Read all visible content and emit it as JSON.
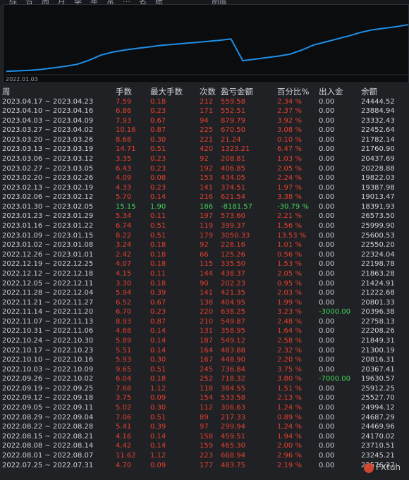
{
  "tabs": [
    "综",
    "合",
    "周",
    "月",
    "季",
    "年",
    "常",
    "…",
    "名",
    "账",
    "制度"
  ],
  "chart": {
    "start_label": "2022.01.03",
    "line_color": "#1e8fe8",
    "equity_series": [
      0.08,
      0.09,
      0.1,
      0.12,
      0.15,
      0.18,
      0.22,
      0.3,
      0.4,
      0.46,
      0.5,
      0.53,
      0.56,
      0.59,
      0.61,
      0.63,
      0.65,
      0.67,
      0.69,
      0.72,
      0.29,
      0.32,
      0.35,
      0.38,
      0.42,
      0.5,
      0.6,
      0.66,
      0.72,
      0.78,
      0.85,
      0.9,
      0.93,
      0.96,
      1.0
    ]
  },
  "table": {
    "headers": [
      "周",
      "手数",
      "最大手数",
      "次数",
      "盈亏金额",
      "百分比%",
      "出入金",
      "余额"
    ],
    "rows": [
      {
        "week": "2023.04.17 ~ 2023.04.23",
        "lots": "7.59",
        "max_lots": "0.18",
        "count": "212",
        "pnl": "559.58",
        "pct": "2.34 %",
        "flow": "0.00",
        "balance": "24444.52",
        "sign": "pos"
      },
      {
        "week": "2023.04.10 ~ 2023.04.16",
        "lots": "6.86",
        "max_lots": "0.23",
        "count": "171",
        "pnl": "552.51",
        "pct": "2.37 %",
        "flow": "0.00",
        "balance": "23884.94",
        "sign": "pos"
      },
      {
        "week": "2023.04.03 ~ 2023.04.09",
        "lots": "7.93",
        "max_lots": "0.67",
        "count": "94",
        "pnl": "879.79",
        "pct": "3.92 %",
        "flow": "0.00",
        "balance": "23332.43",
        "sign": "pos"
      },
      {
        "week": "2023.03.27 ~ 2023.04.02",
        "lots": "10.16",
        "max_lots": "0.87",
        "count": "225",
        "pnl": "670.50",
        "pct": "3.08 %",
        "flow": "0.00",
        "balance": "22452.64",
        "sign": "pos"
      },
      {
        "week": "2023.03.20 ~ 2023.03.26",
        "lots": "8.68",
        "max_lots": "0.30",
        "count": "221",
        "pnl": "21.24",
        "pct": "0.10 %",
        "flow": "0.00",
        "balance": "21782.14",
        "sign": "pos"
      },
      {
        "week": "2023.03.13 ~ 2023.03.19",
        "lots": "14.71",
        "max_lots": "0.51",
        "count": "420",
        "pnl": "1323.21",
        "pct": "6.47 %",
        "flow": "0.00",
        "balance": "21760.90",
        "sign": "pos"
      },
      {
        "week": "2023.03.06 ~ 2023.03.12",
        "lots": "3.35",
        "max_lots": "0.23",
        "count": "92",
        "pnl": "208.81",
        "pct": "1.03 %",
        "flow": "0.00",
        "balance": "20437.69",
        "sign": "pos"
      },
      {
        "week": "2023.02.27 ~ 2023.03.05",
        "lots": "6.43",
        "max_lots": "0.23",
        "count": "192",
        "pnl": "406.85",
        "pct": "2.05 %",
        "flow": "0.00",
        "balance": "20228.88",
        "sign": "pos"
      },
      {
        "week": "2023.02.20 ~ 2023.02.26",
        "lots": "4.09",
        "max_lots": "0.08",
        "count": "153",
        "pnl": "434.05",
        "pct": "2.24 %",
        "flow": "0.00",
        "balance": "19822.03",
        "sign": "pos"
      },
      {
        "week": "2023.02.13 ~ 2023.02.19",
        "lots": "4.33",
        "max_lots": "0.23",
        "count": "141",
        "pnl": "374.51",
        "pct": "1.97 %",
        "flow": "0.00",
        "balance": "19387.98",
        "sign": "pos"
      },
      {
        "week": "2023.02.06 ~ 2023.02.12",
        "lots": "5.70",
        "max_lots": "0.14",
        "count": "216",
        "pnl": "621.54",
        "pct": "3.38 %",
        "flow": "0.00",
        "balance": "19013.47",
        "sign": "pos"
      },
      {
        "week": "2023.01.30 ~ 2023.02.05",
        "lots": "15.15",
        "max_lots": "1.90",
        "count": "186",
        "pnl": "-8181.57",
        "pct": "-30.79 %",
        "flow": "0.00",
        "balance": "18391.93",
        "sign": "neg"
      },
      {
        "week": "2023.01.23 ~ 2023.01.29",
        "lots": "5.34",
        "max_lots": "0.11",
        "count": "197",
        "pnl": "573.60",
        "pct": "2.21 %",
        "flow": "0.00",
        "balance": "26573.50",
        "sign": "pos"
      },
      {
        "week": "2023.01.16 ~ 2023.01.22",
        "lots": "6.74",
        "max_lots": "0.51",
        "count": "119",
        "pnl": "399.37",
        "pct": "1.56 %",
        "flow": "0.00",
        "balance": "25999.90",
        "sign": "pos"
      },
      {
        "week": "2023.01.09 ~ 2023.01.15",
        "lots": "8.22",
        "max_lots": "0.51",
        "count": "179",
        "pnl": "3050.33",
        "pct": "13.53 %",
        "flow": "0.00",
        "balance": "25600.53",
        "sign": "pos"
      },
      {
        "week": "2023.01.02 ~ 2023.01.08",
        "lots": "3.24",
        "max_lots": "0.18",
        "count": "92",
        "pnl": "226.16",
        "pct": "1.01 %",
        "flow": "0.00",
        "balance": "22550.20",
        "sign": "pos"
      },
      {
        "week": "2022.12.26 ~ 2023.01.01",
        "lots": "2.42",
        "max_lots": "0.18",
        "count": "66",
        "pnl": "125.26",
        "pct": "0.56 %",
        "flow": "0.00",
        "balance": "22324.04",
        "sign": "pos"
      },
      {
        "week": "2022.12.19 ~ 2022.12.25",
        "lots": "4.07",
        "max_lots": "0.18",
        "count": "115",
        "pnl": "335.50",
        "pct": "1.53 %",
        "flow": "0.00",
        "balance": "22198.78",
        "sign": "pos"
      },
      {
        "week": "2022.12.12 ~ 2022.12.18",
        "lots": "4.15",
        "max_lots": "0.11",
        "count": "144",
        "pnl": "438.37",
        "pct": "2.05 %",
        "flow": "0.00",
        "balance": "21863.28",
        "sign": "pos"
      },
      {
        "week": "2022.12.05 ~ 2022.12.11",
        "lots": "3.30",
        "max_lots": "0.18",
        "count": "90",
        "pnl": "202.23",
        "pct": "0.95 %",
        "flow": "0.00",
        "balance": "21424.91",
        "sign": "pos"
      },
      {
        "week": "2022.11.28 ~ 2022.12.04",
        "lots": "5.94",
        "max_lots": "0.39",
        "count": "141",
        "pnl": "421.35",
        "pct": "2.03 %",
        "flow": "0.00",
        "balance": "21222.68",
        "sign": "pos"
      },
      {
        "week": "2022.11.21 ~ 2022.11.27",
        "lots": "6.52",
        "max_lots": "0.67",
        "count": "138",
        "pnl": "404.95",
        "pct": "1.99 %",
        "flow": "0.00",
        "balance": "20801.33",
        "sign": "pos"
      },
      {
        "week": "2022.11.14 ~ 2022.11.20",
        "lots": "6.70",
        "max_lots": "0.23",
        "count": "220",
        "pnl": "638.25",
        "pct": "3.23 %",
        "flow": "-3000.00",
        "balance": "20396.38",
        "sign": "pos"
      },
      {
        "week": "2022.11.07 ~ 2022.11.13",
        "lots": "8.93",
        "max_lots": "0.87",
        "count": "210",
        "pnl": "549.87",
        "pct": "2.48 %",
        "flow": "0.00",
        "balance": "22758.13",
        "sign": "pos"
      },
      {
        "week": "2022.10.31 ~ 2022.11.06",
        "lots": "4.68",
        "max_lots": "0.14",
        "count": "131",
        "pnl": "358.95",
        "pct": "1.64 %",
        "flow": "0.00",
        "balance": "22208.26",
        "sign": "pos"
      },
      {
        "week": "2022.10.24 ~ 2022.10.30",
        "lots": "5.89",
        "max_lots": "0.14",
        "count": "187",
        "pnl": "549.12",
        "pct": "2.58 %",
        "flow": "0.00",
        "balance": "21849.31",
        "sign": "pos"
      },
      {
        "week": "2022.10.17 ~ 2022.10.23",
        "lots": "5.51",
        "max_lots": "0.14",
        "count": "164",
        "pnl": "483.88",
        "pct": "2.32 %",
        "flow": "0.00",
        "balance": "21300.19",
        "sign": "pos"
      },
      {
        "week": "2022.10.10 ~ 2022.10.16",
        "lots": "5.93",
        "max_lots": "0.30",
        "count": "167",
        "pnl": "448.90",
        "pct": "2.20 %",
        "flow": "0.00",
        "balance": "20816.31",
        "sign": "pos"
      },
      {
        "week": "2022.10.03 ~ 2022.10.09",
        "lots": "9.65",
        "max_lots": "0.51",
        "count": "245",
        "pnl": "736.84",
        "pct": "3.75 %",
        "flow": "0.00",
        "balance": "20367.41",
        "sign": "pos"
      },
      {
        "week": "2022.09.26 ~ 2022.10.02",
        "lots": "6.04",
        "max_lots": "0.18",
        "count": "252",
        "pnl": "718.32",
        "pct": "3.80 %",
        "flow": "-7000.00",
        "balance": "19630.57",
        "sign": "pos"
      },
      {
        "week": "2022.09.19 ~ 2022.09.25",
        "lots": "7.68",
        "max_lots": "1.12",
        "count": "118",
        "pnl": "384.55",
        "pct": "1.51 %",
        "flow": "0.00",
        "balance": "25912.25",
        "sign": "pos"
      },
      {
        "week": "2022.09.12 ~ 2022.09.18",
        "lots": "3.75",
        "max_lots": "0.09",
        "count": "154",
        "pnl": "533.58",
        "pct": "2.13 %",
        "flow": "0.00",
        "balance": "25527.70",
        "sign": "pos"
      },
      {
        "week": "2022.09.05 ~ 2022.09.11",
        "lots": "5.02",
        "max_lots": "0.30",
        "count": "112",
        "pnl": "306.63",
        "pct": "1.24 %",
        "flow": "0.00",
        "balance": "24994.12",
        "sign": "pos"
      },
      {
        "week": "2022.08.29 ~ 2022.09.04",
        "lots": "7.06",
        "max_lots": "0.51",
        "count": "89",
        "pnl": "217.33",
        "pct": "0.89 %",
        "flow": "0.00",
        "balance": "24687.29",
        "sign": "pos"
      },
      {
        "week": "2022.08.22 ~ 2022.08.28",
        "lots": "5.41",
        "max_lots": "0.39",
        "count": "97",
        "pnl": "299.94",
        "pct": "1.24 %",
        "flow": "0.00",
        "balance": "24469.96",
        "sign": "pos"
      },
      {
        "week": "2022.08.15 ~ 2022.08.21",
        "lots": "4.16",
        "max_lots": "0.14",
        "count": "158",
        "pnl": "459.51",
        "pct": "1.94 %",
        "flow": "0.00",
        "balance": "24170.02",
        "sign": "pos"
      },
      {
        "week": "2022.08.08 ~ 2022.08.14",
        "lots": "4.42",
        "max_lots": "0.14",
        "count": "159",
        "pnl": "465.30",
        "pct": "2.00 %",
        "flow": "0.00",
        "balance": "23710.51",
        "sign": "pos"
      },
      {
        "week": "2022.08.01 ~ 2022.08.07",
        "lots": "11.62",
        "max_lots": "1.12",
        "count": "223",
        "pnl": "668.94",
        "pct": "2.96 %",
        "flow": "0.00",
        "balance": "23245.21",
        "sign": "pos"
      },
      {
        "week": "2022.07.25 ~ 2022.07.31",
        "lots": "4.70",
        "max_lots": "0.09",
        "count": "177",
        "pnl": "483.75",
        "pct": "2.19 %",
        "flow": "0.00",
        "balance": "22576.27",
        "sign": "pos"
      }
    ]
  },
  "watermark": {
    "text": "FXtuh",
    "logo_color": "#e04a32"
  }
}
